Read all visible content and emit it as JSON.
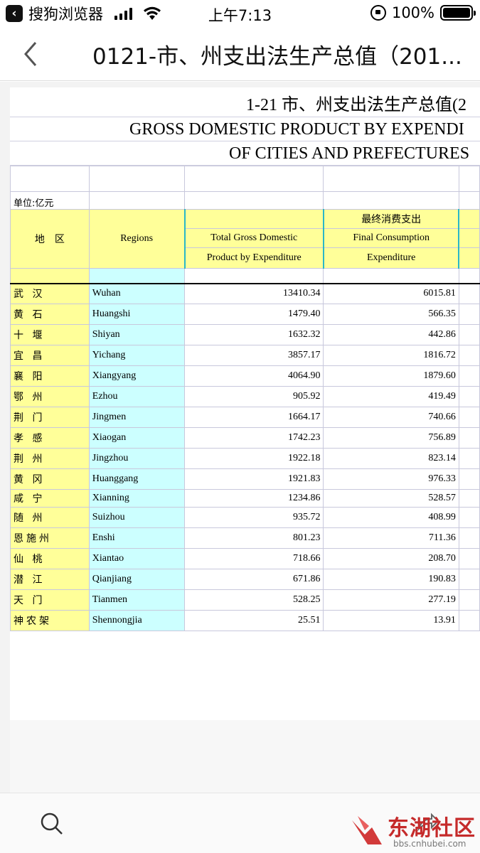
{
  "status_bar": {
    "app_label": "搜狗浏览器",
    "time": "上午7:13",
    "battery": "100%"
  },
  "nav": {
    "title": "0121-市、州支出法生产总值（201..."
  },
  "sheet": {
    "title_cn": "1-21  市、州支出法生产总值(2",
    "title_en1": "GROSS DOMESTIC PRODUCT BY EXPENDI",
    "title_en2": "OF CITIES AND PREFECTURES",
    "unit": "单位:亿元",
    "header": {
      "region_cn": "地　区",
      "region_en": "Regions",
      "col1_line1": "Total Gross Domestic",
      "col1_line2": "Product by Expenditure",
      "col2_cn": "最终消费支出",
      "col2_line1": "Final Consumption",
      "col2_line2": "Expenditure"
    },
    "rows": [
      {
        "cn": "武 汉",
        "en": "Wuhan",
        "gdp": "13410.34",
        "fce": "6015.81"
      },
      {
        "cn": "黄 石",
        "en": "Huangshi",
        "gdp": "1479.40",
        "fce": "566.35"
      },
      {
        "cn": "十 堰",
        "en": "Shiyan",
        "gdp": "1632.32",
        "fce": "442.86"
      },
      {
        "cn": "宜 昌",
        "en": "Yichang",
        "gdp": "3857.17",
        "fce": "1816.72"
      },
      {
        "cn": "襄 阳",
        "en": "Xiangyang",
        "gdp": "4064.90",
        "fce": "1879.60"
      },
      {
        "cn": "鄂 州",
        "en": " Ezhou",
        "gdp": "905.92",
        "fce": "419.49"
      },
      {
        "cn": "荆 门",
        "en": "Jingmen",
        "gdp": "1664.17",
        "fce": "740.66"
      },
      {
        "cn": "孝 感",
        "en": "Xiaogan",
        "gdp": "1742.23",
        "fce": "756.89"
      },
      {
        "cn": "荆 州",
        "en": "Jingzhou",
        "gdp": "1922.18",
        "fce": "823.14"
      },
      {
        "cn": "黄 冈",
        "en": "Huanggang",
        "gdp": "1921.83",
        "fce": "976.33"
      },
      {
        "cn": "咸 宁",
        "en": "Xianning",
        "gdp": "1234.86",
        "fce": "528.57"
      },
      {
        "cn": "随 州",
        "en": "Suizhou",
        "gdp": "935.72",
        "fce": "408.99"
      },
      {
        "cn": "恩施州",
        "en": "Enshi",
        "gdp": "801.23",
        "fce": "711.36"
      },
      {
        "cn": "仙 桃",
        "en": "Xiantao",
        "gdp": "718.66",
        "fce": "208.70"
      },
      {
        "cn": "潜 江",
        "en": "Qianjiang",
        "gdp": "671.86",
        "fce": "190.83"
      },
      {
        "cn": "天 门",
        "en": "Tianmen",
        "gdp": "528.25",
        "fce": "277.19"
      },
      {
        "cn": "神农架",
        "en": "Shennongjia",
        "gdp": "25.51",
        "fce": "13.91"
      }
    ]
  },
  "watermark": {
    "text": "东湖社区",
    "url": "bbs.cnhubei.com"
  },
  "colors": {
    "header_yellow": "#ffff99",
    "region_cyan": "#ccffff",
    "watermark_red": "#c52b2b"
  }
}
